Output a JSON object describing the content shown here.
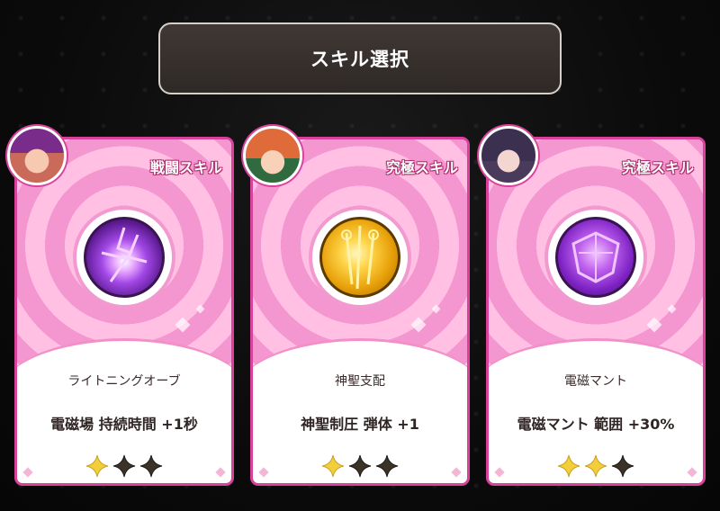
{
  "title": "スキル選択",
  "cards": [
    {
      "type_label": "戦闘スキル",
      "skill_name": "ライトニングオーブ",
      "effect": "電磁場 持続時間 +1秒",
      "stars_filled": 1,
      "stars_total": 3,
      "icon": "lightning-orb-icon",
      "avatar": "witch-avatar"
    },
    {
      "type_label": "究極スキル",
      "skill_name": "神聖支配",
      "effect": "神聖制圧 弾体 +1",
      "stars_filled": 1,
      "stars_total": 3,
      "icon": "holy-domination-icon",
      "avatar": "redhead-avatar"
    },
    {
      "type_label": "究極スキル",
      "skill_name": "電磁マント",
      "effect": "電磁マント 範囲 +30%",
      "stars_filled": 2,
      "stars_total": 3,
      "icon": "electromagnetic-cloak-icon",
      "avatar": "dark-hair-avatar"
    }
  ],
  "colors": {
    "card_border": "#d9429b",
    "star_filled": "#f2cf3a",
    "star_empty": "#3b3328"
  }
}
